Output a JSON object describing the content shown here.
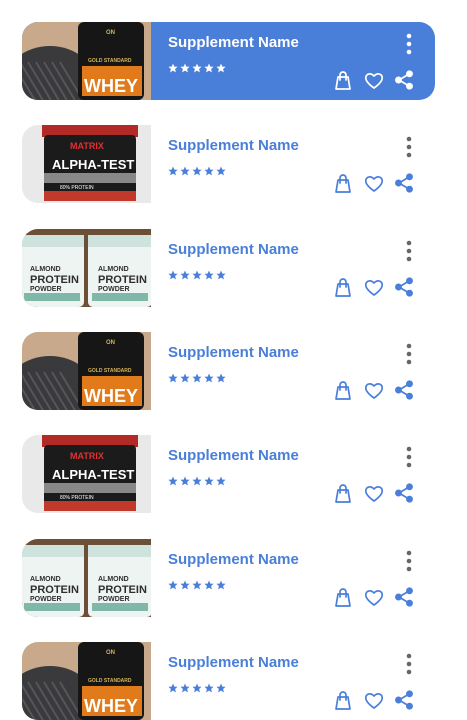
{
  "theme": {
    "accent": "#4a7fd9",
    "selected_bg": "#4a7fd9",
    "text_on_accent": "#ffffff"
  },
  "products": [
    {
      "name": "Supplement Name",
      "rating": 5,
      "image": "whey-tub-image",
      "selected": true
    },
    {
      "name": "Supplement Name",
      "rating": 5,
      "image": "alpha-test-tub-image",
      "selected": false
    },
    {
      "name": "Supplement Name",
      "rating": 5,
      "image": "protein-powder-jars-image",
      "selected": false
    },
    {
      "name": "Supplement Name",
      "rating": 5,
      "image": "whey-tub-image",
      "selected": false
    },
    {
      "name": "Supplement Name",
      "rating": 5,
      "image": "alpha-test-tub-image",
      "selected": false
    },
    {
      "name": "Supplement Name",
      "rating": 5,
      "image": "protein-powder-jars-image",
      "selected": false
    },
    {
      "name": "Supplement Name",
      "rating": 5,
      "image": "whey-tub-image",
      "selected": false
    }
  ],
  "image_labels": {
    "whey": {
      "top": "GOLD STANDARD",
      "main": "WHEY",
      "brand": "ON"
    },
    "alpha": {
      "brand": "MATRIX",
      "main": "ALPHA-TEST",
      "sub": "80% PROTEIN"
    },
    "protein": {
      "line1": "ALMOND",
      "line2": "PROTEIN",
      "line3": "POWDER"
    }
  },
  "icons": {
    "more": "more-vertical-icon",
    "bag": "shopping-bag-icon",
    "heart": "heart-icon",
    "share": "share-icon",
    "star": "star-icon"
  }
}
